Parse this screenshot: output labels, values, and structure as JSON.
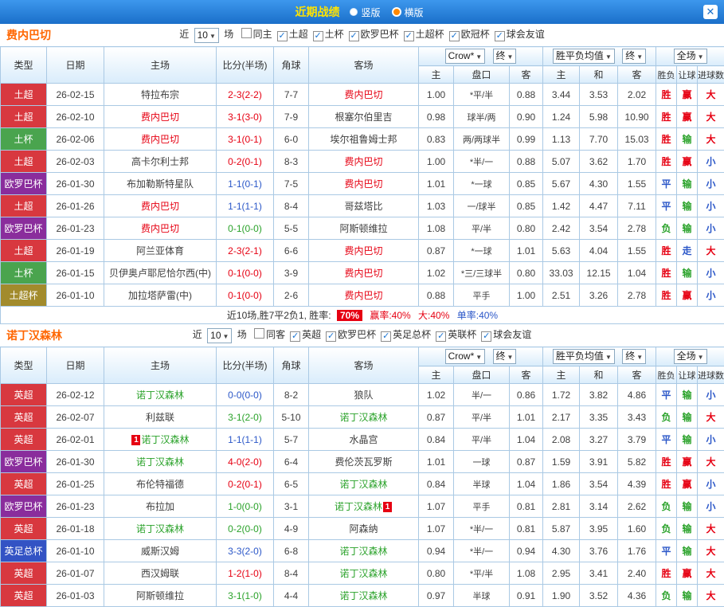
{
  "topbar": {
    "title": "近期战绩",
    "radio_vertical": "竖版",
    "radio_horizontal": "横版",
    "selected": "横版",
    "close_glyph": "✕"
  },
  "icons": {
    "dropdown_arrow": "▼",
    "check": "✓"
  },
  "opponent_color": "#404040",
  "league_colors": {
    "土超": "#d8383f",
    "土杯": "#4aa44e",
    "欧罗巴杯": "#8a2d9c",
    "土超杯": "#a28b2c",
    "英超": "#d8383f",
    "英足总杯": "#3353c4"
  },
  "score_colors": {
    "win": "#e60012",
    "draw": "#2b57c8",
    "loss": "#2aa22a"
  },
  "result_colors": {
    "胜": "#e60012",
    "赢": "#e60012",
    "大": "#e60012",
    "平": "#2b57c8",
    "走": "#2b57c8",
    "小": "#2b57c8",
    "负": "#2aa22a",
    "输": "#2aa22a"
  },
  "sections": [
    {
      "team": "费内巴切",
      "team_color": "#e60012",
      "filters": {
        "near_label": "近",
        "games_value": "10",
        "games_suffix": "场",
        "checkboxes": [
          {
            "label": "同主",
            "checked": false
          },
          {
            "label": "土超",
            "checked": true
          },
          {
            "label": "土杯",
            "checked": true
          },
          {
            "label": "欧罗巴杯",
            "checked": true
          },
          {
            "label": "土超杯",
            "checked": true
          },
          {
            "label": "欧冠杯",
            "checked": true
          },
          {
            "label": "球会友谊",
            "checked": true
          }
        ]
      },
      "header": {
        "col_type": "类型",
        "col_date": "日期",
        "col_home": "主场",
        "col_score": "比分(半场)",
        "col_corner": "角球",
        "col_away": "客场",
        "odds_dropdown": "Crow*",
        "odds_final": "终",
        "avg_dropdown": "胜平负均值",
        "avg_final": "终",
        "full_dropdown": "全场",
        "sub": [
          "主",
          "盘口",
          "客",
          "主",
          "和",
          "客",
          "胜负",
          "让球",
          "进球数"
        ]
      },
      "rows": [
        {
          "league": "土超",
          "date": "26-02-15",
          "home": "特拉布宗",
          "home_is_team": false,
          "home_cards": 0,
          "score": "2-3(2-2)",
          "outcome": "win",
          "corner": "7-7",
          "away": "费内巴切",
          "away_is_team": true,
          "away_cards": 0,
          "odds": [
            "1.00",
            "*平/半",
            "0.88"
          ],
          "avg": [
            "3.44",
            "3.53",
            "2.02"
          ],
          "marks": [
            "胜",
            "赢",
            "大"
          ]
        },
        {
          "league": "土超",
          "date": "26-02-10",
          "home": "费内巴切",
          "home_is_team": true,
          "home_cards": 0,
          "score": "3-1(3-0)",
          "outcome": "win",
          "corner": "7-9",
          "away": "根塞尔伯里吉",
          "away_is_team": false,
          "away_cards": 0,
          "odds": [
            "0.98",
            "球半/两",
            "0.90"
          ],
          "avg": [
            "1.24",
            "5.98",
            "10.90"
          ],
          "marks": [
            "胜",
            "赢",
            "大"
          ]
        },
        {
          "league": "土杯",
          "date": "26-02-06",
          "home": "费内巴切",
          "home_is_team": true,
          "home_cards": 0,
          "score": "3-1(0-1)",
          "outcome": "win",
          "corner": "6-0",
          "away": "埃尔祖鲁姆士邦",
          "away_is_team": false,
          "away_cards": 0,
          "odds": [
            "0.83",
            "两/两球半",
            "0.99"
          ],
          "avg": [
            "1.13",
            "7.70",
            "15.03"
          ],
          "marks": [
            "胜",
            "输",
            "大"
          ]
        },
        {
          "league": "土超",
          "date": "26-02-03",
          "home": "高卡尔利士邦",
          "home_is_team": false,
          "home_cards": 0,
          "score": "0-2(0-1)",
          "outcome": "win",
          "corner": "8-3",
          "away": "费内巴切",
          "away_is_team": true,
          "away_cards": 0,
          "odds": [
            "1.00",
            "*半/一",
            "0.88"
          ],
          "avg": [
            "5.07",
            "3.62",
            "1.70"
          ],
          "marks": [
            "胜",
            "赢",
            "小"
          ]
        },
        {
          "league": "欧罗巴杯",
          "date": "26-01-30",
          "home": "布加勒斯特星队",
          "home_is_team": false,
          "home_cards": 0,
          "score": "1-1(0-1)",
          "outcome": "draw",
          "corner": "7-5",
          "away": "费内巴切",
          "away_is_team": true,
          "away_cards": 0,
          "odds": [
            "1.01",
            "*一球",
            "0.85"
          ],
          "avg": [
            "5.67",
            "4.30",
            "1.55"
          ],
          "marks": [
            "平",
            "输",
            "小"
          ]
        },
        {
          "league": "土超",
          "date": "26-01-26",
          "home": "费内巴切",
          "home_is_team": true,
          "home_cards": 0,
          "score": "1-1(1-1)",
          "outcome": "draw",
          "corner": "8-4",
          "away": "哥兹塔比",
          "away_is_team": false,
          "away_cards": 0,
          "odds": [
            "1.03",
            "一/球半",
            "0.85"
          ],
          "avg": [
            "1.42",
            "4.47",
            "7.11"
          ],
          "marks": [
            "平",
            "输",
            "小"
          ]
        },
        {
          "league": "欧罗巴杯",
          "date": "26-01-23",
          "home": "费内巴切",
          "home_is_team": true,
          "home_cards": 0,
          "score": "0-1(0-0)",
          "outcome": "loss",
          "corner": "5-5",
          "away": "阿斯顿维拉",
          "away_is_team": false,
          "away_cards": 0,
          "odds": [
            "1.08",
            "平/半",
            "0.80"
          ],
          "avg": [
            "2.42",
            "3.54",
            "2.78"
          ],
          "marks": [
            "负",
            "输",
            "小"
          ]
        },
        {
          "league": "土超",
          "date": "26-01-19",
          "home": "阿兰亚体育",
          "home_is_team": false,
          "home_cards": 0,
          "score": "2-3(2-1)",
          "outcome": "win",
          "corner": "6-6",
          "away": "费内巴切",
          "away_is_team": true,
          "away_cards": 0,
          "odds": [
            "0.87",
            "*一球",
            "1.01"
          ],
          "avg": [
            "5.63",
            "4.04",
            "1.55"
          ],
          "marks": [
            "胜",
            "走",
            "大"
          ]
        },
        {
          "league": "土杯",
          "date": "26-01-15",
          "home": "贝伊奥卢耶尼恰尔西(中)",
          "home_is_team": false,
          "home_cards": 0,
          "score": "0-1(0-0)",
          "outcome": "win",
          "corner": "3-9",
          "away": "费内巴切",
          "away_is_team": true,
          "away_cards": 0,
          "odds": [
            "1.02",
            "*三/三球半",
            "0.80"
          ],
          "avg": [
            "33.03",
            "12.15",
            "1.04"
          ],
          "marks": [
            "胜",
            "输",
            "小"
          ]
        },
        {
          "league": "土超杯",
          "date": "26-01-10",
          "home": "加拉塔萨雷(中)",
          "home_is_team": false,
          "home_cards": 0,
          "score": "0-1(0-0)",
          "outcome": "win",
          "corner": "2-6",
          "away": "费内巴切",
          "away_is_team": true,
          "away_cards": 0,
          "odds": [
            "0.88",
            "平手",
            "1.00"
          ],
          "avg": [
            "2.51",
            "3.26",
            "2.78"
          ],
          "marks": [
            "胜",
            "赢",
            "小"
          ]
        }
      ],
      "summary": {
        "text": "近10场,胜7平2负1, 胜率:",
        "badge": "70%",
        "win_rate": "赢率:40%",
        "big_rate": "大:40%",
        "single_rate": "单率:40%"
      }
    },
    {
      "team": "诺丁汉森林",
      "team_color": "#2aa22a",
      "filters": {
        "near_label": "近",
        "games_value": "10",
        "games_suffix": "场",
        "checkboxes": [
          {
            "label": "同客",
            "checked": false
          },
          {
            "label": "英超",
            "checked": true
          },
          {
            "label": "欧罗巴杯",
            "checked": true
          },
          {
            "label": "英足总杯",
            "checked": true
          },
          {
            "label": "英联杯",
            "checked": true
          },
          {
            "label": "球会友谊",
            "checked": true
          }
        ]
      },
      "header": {
        "col_type": "类型",
        "col_date": "日期",
        "col_home": "主场",
        "col_score": "比分(半场)",
        "col_corner": "角球",
        "col_away": "客场",
        "odds_dropdown": "Crow*",
        "odds_final": "终",
        "avg_dropdown": "胜平负均值",
        "avg_final": "终",
        "full_dropdown": "全场",
        "sub": [
          "主",
          "盘口",
          "客",
          "主",
          "和",
          "客",
          "胜负",
          "让球",
          "进球数"
        ]
      },
      "rows": [
        {
          "league": "英超",
          "date": "26-02-12",
          "home": "诺丁汉森林",
          "home_is_team": true,
          "home_cards": 0,
          "score": "0-0(0-0)",
          "outcome": "draw",
          "corner": "8-2",
          "away": "狼队",
          "away_is_team": false,
          "away_cards": 0,
          "odds": [
            "1.02",
            "半/一",
            "0.86"
          ],
          "avg": [
            "1.72",
            "3.82",
            "4.86"
          ],
          "marks": [
            "平",
            "输",
            "小"
          ]
        },
        {
          "league": "英超",
          "date": "26-02-07",
          "home": "利兹联",
          "home_is_team": false,
          "home_cards": 0,
          "score": "3-1(2-0)",
          "outcome": "loss",
          "corner": "5-10",
          "away": "诺丁汉森林",
          "away_is_team": true,
          "away_cards": 0,
          "odds": [
            "0.87",
            "平/半",
            "1.01"
          ],
          "avg": [
            "2.17",
            "3.35",
            "3.43"
          ],
          "marks": [
            "负",
            "输",
            "大"
          ]
        },
        {
          "league": "英超",
          "date": "26-02-01",
          "home": "诺丁汉森林",
          "home_is_team": true,
          "home_cards": 1,
          "score": "1-1(1-1)",
          "outcome": "draw",
          "corner": "5-7",
          "away": "水晶宫",
          "away_is_team": false,
          "away_cards": 0,
          "odds": [
            "0.84",
            "平/半",
            "1.04"
          ],
          "avg": [
            "2.08",
            "3.27",
            "3.79"
          ],
          "marks": [
            "平",
            "输",
            "小"
          ]
        },
        {
          "league": "欧罗巴杯",
          "date": "26-01-30",
          "home": "诺丁汉森林",
          "home_is_team": true,
          "home_cards": 0,
          "score": "4-0(2-0)",
          "outcome": "win",
          "corner": "6-4",
          "away": "费伦茨瓦罗斯",
          "away_is_team": false,
          "away_cards": 0,
          "odds": [
            "1.01",
            "一球",
            "0.87"
          ],
          "avg": [
            "1.59",
            "3.91",
            "5.82"
          ],
          "marks": [
            "胜",
            "赢",
            "大"
          ]
        },
        {
          "league": "英超",
          "date": "26-01-25",
          "home": "布伦特福德",
          "home_is_team": false,
          "home_cards": 0,
          "score": "0-2(0-1)",
          "outcome": "win",
          "corner": "6-5",
          "away": "诺丁汉森林",
          "away_is_team": true,
          "away_cards": 0,
          "odds": [
            "0.84",
            "半球",
            "1.04"
          ],
          "avg": [
            "1.86",
            "3.54",
            "4.39"
          ],
          "marks": [
            "胜",
            "赢",
            "小"
          ]
        },
        {
          "league": "欧罗巴杯",
          "date": "26-01-23",
          "home": "布拉加",
          "home_is_team": false,
          "home_cards": 0,
          "score": "1-0(0-0)",
          "outcome": "loss",
          "corner": "3-1",
          "away": "诺丁汉森林",
          "away_is_team": true,
          "away_cards": 1,
          "odds": [
            "1.07",
            "平手",
            "0.81"
          ],
          "avg": [
            "2.81",
            "3.14",
            "2.62"
          ],
          "marks": [
            "负",
            "输",
            "小"
          ]
        },
        {
          "league": "英超",
          "date": "26-01-18",
          "home": "诺丁汉森林",
          "home_is_team": true,
          "home_cards": 0,
          "score": "0-2(0-0)",
          "outcome": "loss",
          "corner": "4-9",
          "away": "阿森纳",
          "away_is_team": false,
          "away_cards": 0,
          "odds": [
            "1.07",
            "*半/一",
            "0.81"
          ],
          "avg": [
            "5.87",
            "3.95",
            "1.60"
          ],
          "marks": [
            "负",
            "输",
            "大"
          ]
        },
        {
          "league": "英足总杯",
          "date": "26-01-10",
          "home": "威斯汉姆",
          "home_is_team": false,
          "home_cards": 0,
          "score": "3-3(2-0)",
          "outcome": "draw",
          "corner": "6-8",
          "away": "诺丁汉森林",
          "away_is_team": true,
          "away_cards": 0,
          "odds": [
            "0.94",
            "*半/一",
            "0.94"
          ],
          "avg": [
            "4.30",
            "3.76",
            "1.76"
          ],
          "marks": [
            "平",
            "输",
            "大"
          ]
        },
        {
          "league": "英超",
          "date": "26-01-07",
          "home": "西汉姆联",
          "home_is_team": false,
          "home_cards": 0,
          "score": "1-2(1-0)",
          "outcome": "win",
          "corner": "8-4",
          "away": "诺丁汉森林",
          "away_is_team": true,
          "away_cards": 0,
          "odds": [
            "0.80",
            "*平/半",
            "1.08"
          ],
          "avg": [
            "2.95",
            "3.41",
            "2.40"
          ],
          "marks": [
            "胜",
            "赢",
            "大"
          ]
        },
        {
          "league": "英超",
          "date": "26-01-03",
          "home": "阿斯顿维拉",
          "home_is_team": false,
          "home_cards": 0,
          "score": "3-1(1-0)",
          "outcome": "loss",
          "corner": "4-4",
          "away": "诺丁汉森林",
          "away_is_team": true,
          "away_cards": 0,
          "odds": [
            "0.97",
            "半球",
            "0.91"
          ],
          "avg": [
            "1.90",
            "3.52",
            "4.36"
          ],
          "marks": [
            "负",
            "输",
            "大"
          ]
        }
      ],
      "summary": null
    }
  ]
}
